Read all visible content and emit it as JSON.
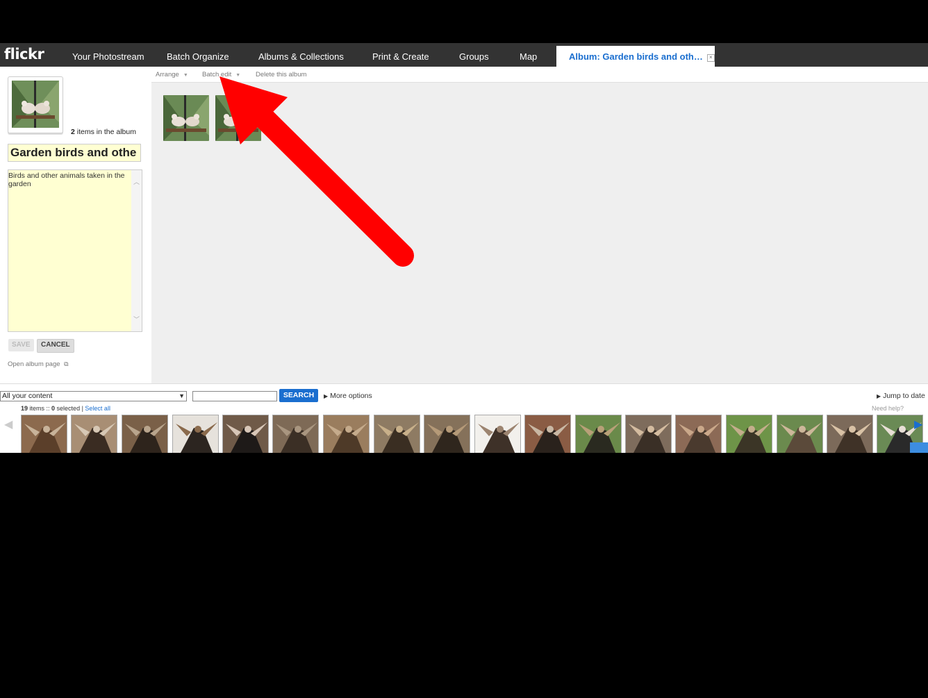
{
  "nav": {
    "logo": "flickr",
    "tabs": [
      {
        "label": "Your Photostream"
      },
      {
        "label": "Batch Organize"
      },
      {
        "label": "Albums & Collections"
      },
      {
        "label": "Print & Create"
      },
      {
        "label": "Groups"
      },
      {
        "label": "Map"
      }
    ],
    "active_tab": "Album: Garden birds and oth…",
    "close_glyph": "×"
  },
  "album": {
    "count_number": "2",
    "count_suffix": " items in the album",
    "title_value": "Garden birds and othe",
    "description": "Birds and other animals taken in the garden",
    "save_label": "SAVE",
    "cancel_label": "CANCEL",
    "open_page_label": "Open album page"
  },
  "toolbar": {
    "arrange": "Arrange",
    "batch_edit": "Batch edit",
    "delete": "Delete this album"
  },
  "organizer": {
    "filter_value": "All your content",
    "search_label": "SEARCH",
    "more_options": "More options",
    "jump_to_date": "Jump to date",
    "items_count": "19",
    "items_text": " items :: ",
    "selected_count": "0",
    "selected_text": " selected | ",
    "select_all": "Select all",
    "need_help": "Need help?"
  },
  "colors": {
    "accent": "#1a6ecf",
    "annotation_arrow": "#ff0000",
    "nav_bg": "#333333",
    "field_bg": "#ffffd2"
  }
}
